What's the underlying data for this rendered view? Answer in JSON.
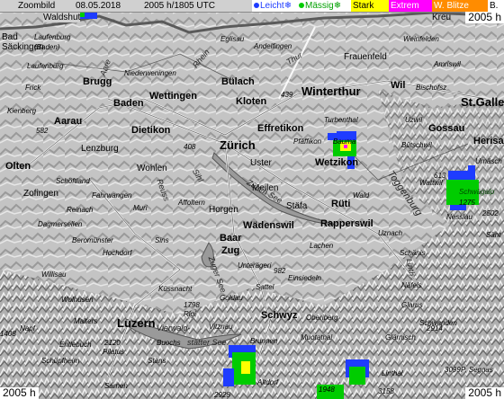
{
  "header": {
    "product": "Zoombild",
    "date": "08.05.2018",
    "time": "2005 h/1805 UTC",
    "legend": [
      {
        "label": "Leicht",
        "icon": "snowflake-icon",
        "color": "#1e3cff"
      },
      {
        "label": "Mässig",
        "icon": "snowflake-icon",
        "color": "#00cc00"
      },
      {
        "label": "Stark",
        "color": "#ffff00"
      },
      {
        "label": "Extrem",
        "color": "#ff00ff"
      },
      {
        "label": "W. Blitze",
        "color": "#ff8c00"
      },
      {
        "label": "B.",
        "color": "#ffffff"
      }
    ]
  },
  "corners": {
    "top_right": "2005 h",
    "bottom_left": "2005 h",
    "bottom_right": "2005 h"
  },
  "places": {
    "waldshut": "Waldshut",
    "kreuzlingen": "Kreu",
    "bad_sackingen": "Bad\nSäckingen",
    "laufenburg_baden": "Laufenburg\n(Baden)",
    "laufenburg": "Laufenburg",
    "eglisau": "Eglisau",
    "andelfingen": "Andelfingen",
    "frauenfeld": "Frauenfeld",
    "weinfelden": "Weinfelden",
    "amriswil": "Amriswil",
    "niederweningen": "Niederweningen",
    "frick": "Frick",
    "brugg": "Brugg",
    "bulach": "Bülach",
    "winterthur": "Winterthur",
    "wil": "Wil",
    "bischofszell": "Bischofsz",
    "st_gallen": "St.Gallen",
    "wettingen": "Wettingen",
    "baden": "Baden",
    "kloten": "Kloten",
    "turbenthal": "Turbenthal",
    "kienberg": "Kienberg",
    "aarau": "Aarau",
    "dietikon": "Dietikon",
    "effretikon": "Effretikon",
    "uzwil": "Uzwil",
    "gossau": "Gossau",
    "zurich": "Zürich",
    "pfaffikon": "Pfäffikon",
    "bauma": "Bauma",
    "herisau": "Herisau",
    "lenzburg": "Lenzburg",
    "buetschwil": "Bütschwil",
    "olten": "Olten",
    "wohlen": "Wohlen",
    "uster": "Uster",
    "wetzikon": "Wetzikon",
    "urnasch": "Urnäsch",
    "schoftland": "Schöftland",
    "wattwil": "Wattwil",
    "zofingen": "Zofingen",
    "fahrwangen": "Fahrwangen",
    "affoltern": "Affoltern",
    "meilen": "Meilen",
    "wald": "Wald",
    "schwagalp": "Schwägalp",
    "reinach": "Reinach",
    "muri": "Muri",
    "horgen": "Horgen",
    "stafa": "Stäfa",
    "ruti": "Rüti",
    "nesslau": "Nesslau",
    "dagmersellen": "Dagmersellen",
    "sins": "Sins",
    "baar": "Baar",
    "wadenswil": "Wädenswil",
    "rapperswil": "Rapperswil",
    "sant": "Sänt",
    "beromunster": "Beromünster",
    "hochdorf": "Hochdorf",
    "zug": "Zug",
    "lachen": "Lachen",
    "uznach": "Uznach",
    "schanis": "Schänis",
    "willisau": "Willisau",
    "unterageri": "Unterägeri",
    "einsiedeln": "Einsiedeln",
    "wolhusen": "Wolhusen",
    "kussnacht": "Küssnacht",
    "sattel": "Sattel",
    "nafels": "Näfels",
    "malters": "Malters",
    "rigi": "Rigi",
    "goldau": "Goldau",
    "glarus": "Glarus",
    "napf": "Napf",
    "luzern": "Luzern",
    "vitznau": "Vitznau",
    "schwyz": "Schwyz",
    "oberiberg": "Oberiberg",
    "schwanden": "Schwanden",
    "entlebuch": "Entlebuch",
    "pilatus": "Pilatus",
    "buochs": "Buochs",
    "brunnen": "Brunnen",
    "muotathal": "Muotathal",
    "glarnisch": "Glärnisch",
    "schupfheim": "Schüpfheim",
    "stans": "Stans",
    "altdorf": "Altdorf",
    "linthal": "Linthal",
    "sarnen": "Sarnen",
    "p_segnas": "P. Segnas"
  },
  "features": {
    "rhein": "Rhein",
    "thur": "Thur",
    "aare": "Aare",
    "reuss": "Reuss",
    "sihl": "Sihl",
    "zurichsee": "Zürich See",
    "linth": "Linth",
    "toggenburg": "Toggenburg",
    "vierwald": "Vierwald-",
    "stattersee": "stätter See",
    "zugersee": "Zuger See"
  },
  "elevations": {
    "e582": "582",
    "e439": "439",
    "e408": "408",
    "e613": "613",
    "e1798": "1798",
    "e2120": "2120",
    "e2914": "2914",
    "e3099": "3099",
    "e1408": "1408",
    "e2928": "2928",
    "e1948": "1948",
    "e3158": "3158",
    "e2502": "2502",
    "e1275": "1275",
    "e982": "982"
  },
  "radar_colors": {
    "light": "#1e3cff",
    "moderate": "#00cc00",
    "strong": "#ffff00",
    "extreme": "#ff00ff",
    "lightning": "#ff8c00"
  }
}
